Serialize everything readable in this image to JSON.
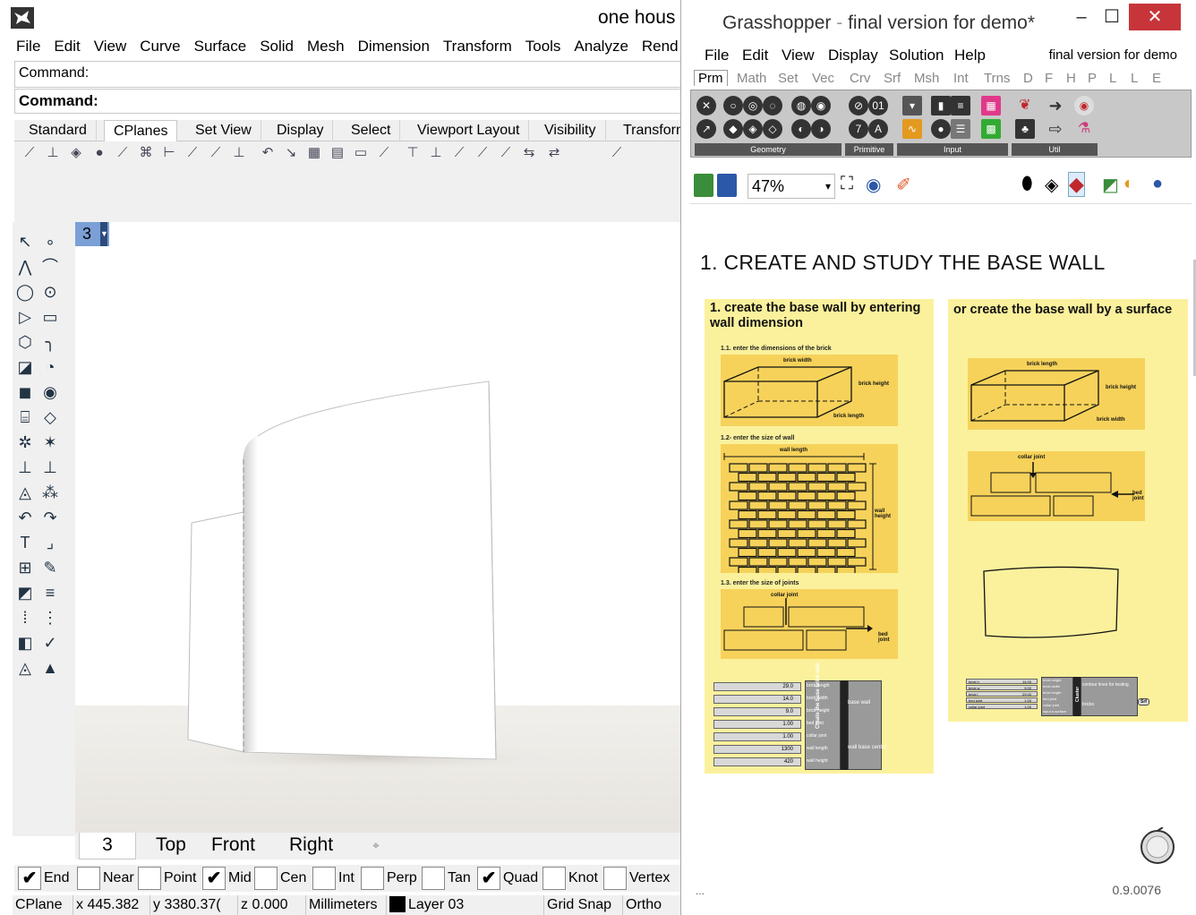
{
  "rhino": {
    "title": "one hous",
    "menu": [
      "File",
      "Edit",
      "View",
      "Curve",
      "Surface",
      "Solid",
      "Mesh",
      "Dimension",
      "Transform",
      "Tools",
      "Analyze",
      "Rend"
    ],
    "command_history": "Command:",
    "command_prompt": "Command:",
    "tabs": [
      "Standard",
      "CPlanes",
      "Set View",
      "Display",
      "Select",
      "Viewport Layout",
      "Visibility",
      "Transforn"
    ],
    "active_tab": "CPlanes",
    "viewport_label": "3",
    "viewport_tabs": [
      "3",
      "Top",
      "Front",
      "Right"
    ],
    "add_viewport_glyph": "⌖",
    "osnaps": [
      {
        "label": "End",
        "checked": true
      },
      {
        "label": "Near",
        "checked": false
      },
      {
        "label": "Point",
        "checked": false
      },
      {
        "label": "Mid",
        "checked": true
      },
      {
        "label": "Cen",
        "checked": false
      },
      {
        "label": "Int",
        "checked": false
      },
      {
        "label": "Perp",
        "checked": false
      },
      {
        "label": "Tan",
        "checked": false
      },
      {
        "label": "Quad",
        "checked": true
      },
      {
        "label": "Knot",
        "checked": false
      },
      {
        "label": "Vertex",
        "checked": false
      }
    ],
    "status": {
      "cplane": "CPlane",
      "x": "x 445.382",
      "y": "y 3380.37(",
      "z": "z 0.000",
      "units": "Millimeters",
      "layer": "Layer 03",
      "grid_snap": "Grid Snap",
      "ortho": "Ortho"
    }
  },
  "grasshopper": {
    "title_app": "Grasshopper",
    "title_sep": " - ",
    "title_doc": "final version for demo*",
    "menu": [
      "File",
      "Edit",
      "View",
      "Display",
      "Solution",
      "Help"
    ],
    "doc_name": "final version for demo",
    "category_tabs": [
      "Prm",
      "Math",
      "Set",
      "Vec",
      "Crv",
      "Srf",
      "Msh",
      "Int",
      "Trns",
      "D",
      "F",
      "H",
      "P",
      "L",
      "L",
      "E"
    ],
    "active_category": "Prm",
    "ribbon_groups": [
      "Geometry",
      "Primitive",
      "Input",
      "Util"
    ],
    "zoom": "47%",
    "heading": "1. CREATE AND STUDY THE BASE WALL",
    "group_left": {
      "title": "1. create the base wall by entering wall dimension",
      "sub1": "1.1. enter the dimensions of the brick",
      "sub2": "1.2- enter the size of wall",
      "sub3": "1.3. enter the size of joints",
      "brick_width": "brick width",
      "brick_height": "brick height",
      "brick_length": "brick length",
      "wall_length": "wall length",
      "wall_height": "wall height",
      "collar_joint": "collar joint",
      "bed_joint": "bed joint",
      "sliders": [
        "29.0",
        "14.0",
        "9.0",
        "1.00",
        "1.00",
        "1300",
        "420"
      ],
      "inputs": [
        "brick length",
        "brick width",
        "brick height",
        "bed joint",
        "collar joint",
        "wall length",
        "wall height"
      ],
      "cluster_label": "Create the base brick wall",
      "outputs": [
        "base wall",
        "wall base center"
      ]
    },
    "group_right": {
      "title": "or create the base wall by a surface",
      "brick_length": "brick length",
      "brick_height": "brick height",
      "brick_width": "brick width",
      "collar_joint": "collar joint",
      "bed_joint": "bed joint",
      "sliders": [
        "14.00",
        "9.00",
        "29.00",
        "1.00",
        "1.00"
      ],
      "slider_names": [
        "brick h",
        "brick w",
        "brick l",
        "bed joint",
        "collar joint"
      ],
      "cluster_label": "Cluster",
      "cluster_inputs": [
        "brick height",
        "brick width",
        "brick length",
        "bed joint",
        "collar joint",
        "input a surface"
      ],
      "cluster_outputs": [
        "contour lines for testing",
        "bricks"
      ],
      "srf_label": "Srf"
    },
    "ellipsis": "...",
    "version": "0.9.0076"
  },
  "colors": {
    "group_fill": "#fbf19c",
    "panel_fill": "#f6d25a",
    "viewport_label": "#7aa0d6",
    "close_button": "#c7353a"
  }
}
